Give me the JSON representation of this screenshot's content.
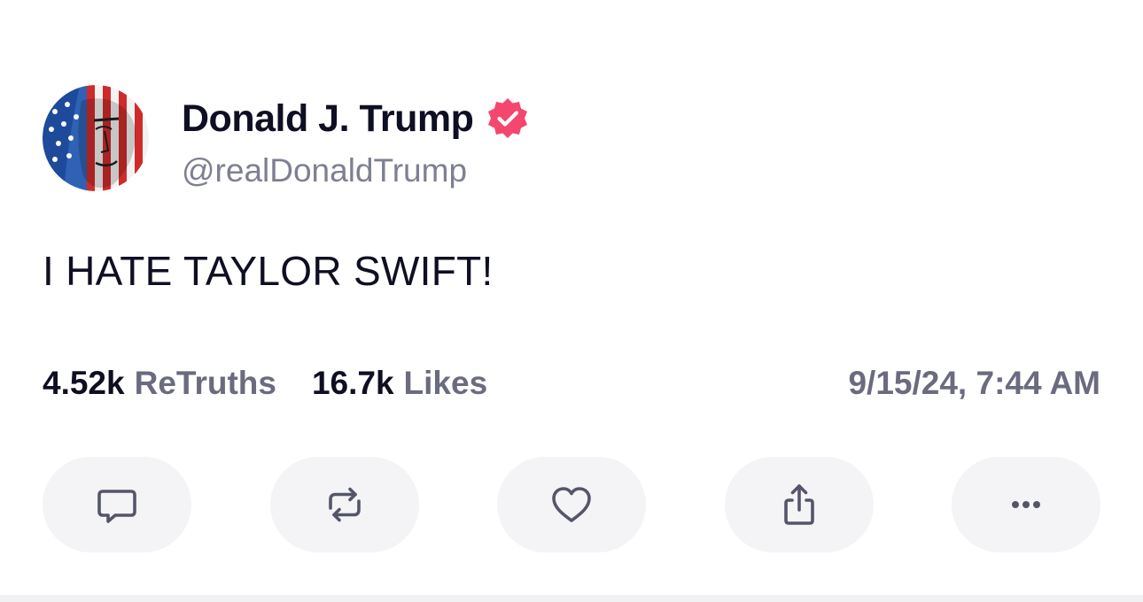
{
  "post": {
    "author": {
      "display_name": "Donald J. Trump",
      "handle": "@realDonaldTrump",
      "verified": true,
      "avatar_icon": "avatar-flag-portrait-icon"
    },
    "text": "I HATE TAYLOR SWIFT!",
    "stats": {
      "retruths_count": "4.52k",
      "retruths_label": "ReTruths",
      "likes_count": "16.7k",
      "likes_label": "Likes"
    },
    "timestamp": "9/15/24, 7:44 AM",
    "actions": [
      {
        "name": "reply",
        "icon": "comment-icon"
      },
      {
        "name": "retruth",
        "icon": "repost-icon"
      },
      {
        "name": "like",
        "icon": "heart-icon"
      },
      {
        "name": "share",
        "icon": "share-icon"
      },
      {
        "name": "more",
        "icon": "more-dots-icon"
      }
    ]
  },
  "colors": {
    "text_primary": "#0f0f23",
    "text_secondary": "#6b6b80",
    "handle": "#7f7f93",
    "verified_badge": "#f4466e",
    "button_bg": "#f4f4f7",
    "icon": "#55556a"
  }
}
